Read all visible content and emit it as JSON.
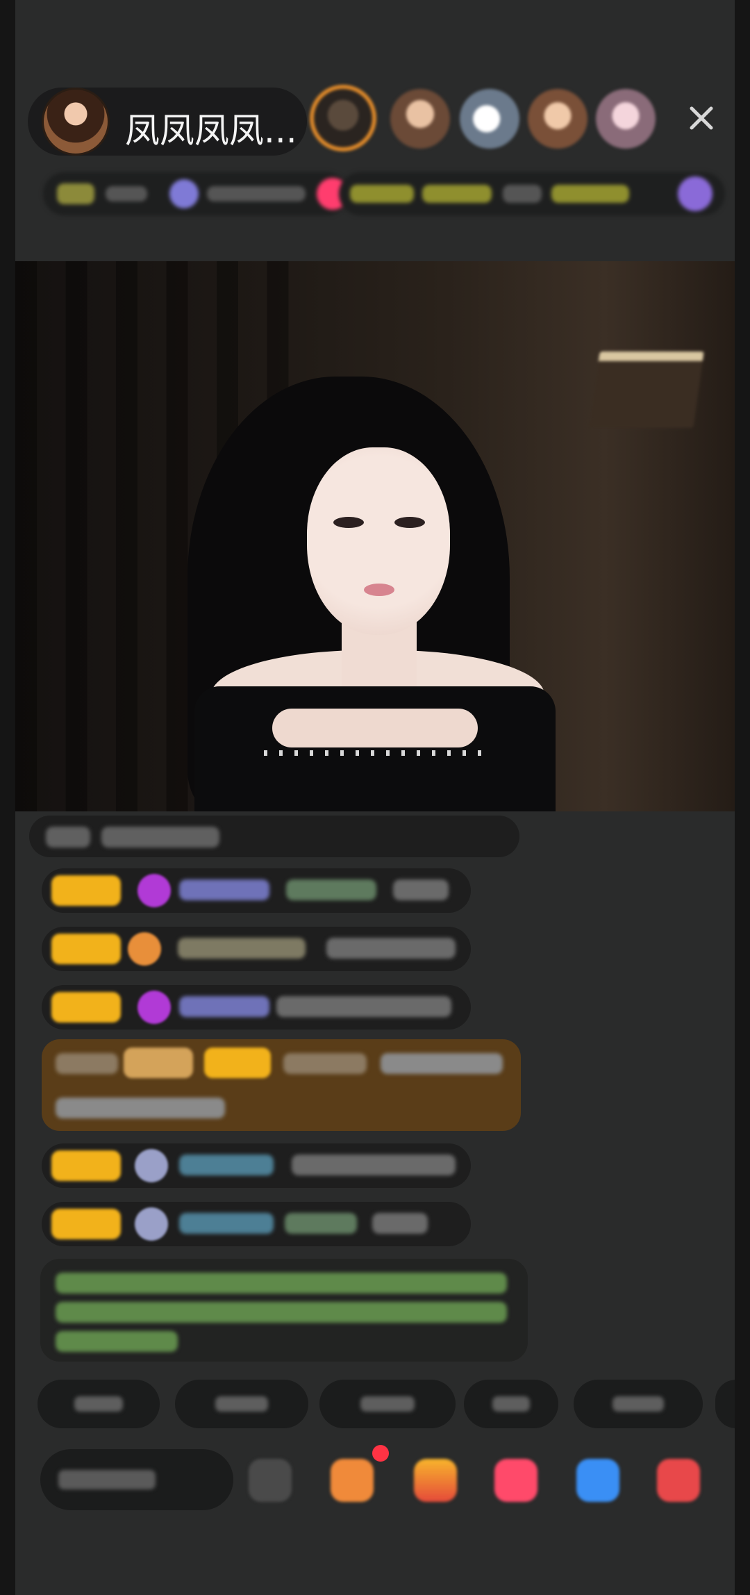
{
  "host": {
    "name": "凤凤凤凤..."
  },
  "icons": {
    "close": "close-icon",
    "gift": "gift-icon",
    "emoji": "emoji-icon",
    "more": "more-icon"
  },
  "colors": {
    "background": "#2a2b2b",
    "badge_gold": "#f2b21b",
    "highlight_brown": "#5a3d18",
    "notification_red": "#ff3344"
  }
}
